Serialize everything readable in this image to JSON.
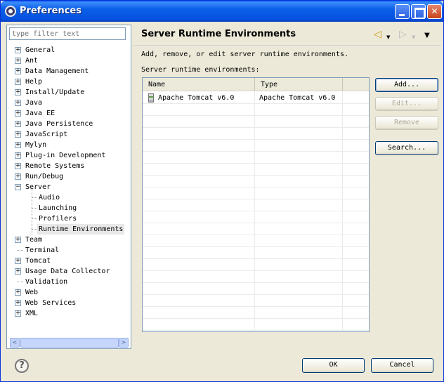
{
  "window": {
    "title": "Preferences"
  },
  "filter": {
    "placeholder": "type filter text"
  },
  "tree": [
    {
      "label": "General",
      "expander": "+"
    },
    {
      "label": "Ant",
      "expander": "+"
    },
    {
      "label": "Data Management",
      "expander": "+"
    },
    {
      "label": "Help",
      "expander": "+"
    },
    {
      "label": "Install/Update",
      "expander": "+"
    },
    {
      "label": "Java",
      "expander": "+"
    },
    {
      "label": "Java EE",
      "expander": "+"
    },
    {
      "label": "Java Persistence",
      "expander": "+"
    },
    {
      "label": "JavaScript",
      "expander": "+"
    },
    {
      "label": "Mylyn",
      "expander": "+"
    },
    {
      "label": "Plug-in Development",
      "expander": "+"
    },
    {
      "label": "Remote Systems",
      "expander": "+"
    },
    {
      "label": "Run/Debug",
      "expander": "+"
    },
    {
      "label": "Server",
      "expander": "−"
    },
    {
      "label": "Audio"
    },
    {
      "label": "Launching"
    },
    {
      "label": "Profilers"
    },
    {
      "label": "Runtime Environments"
    },
    {
      "label": "Team",
      "expander": "+"
    },
    {
      "label": "Terminal"
    },
    {
      "label": "Tomcat",
      "expander": "+"
    },
    {
      "label": "Usage Data Collector",
      "expander": "+"
    },
    {
      "label": "Validation"
    },
    {
      "label": "Web",
      "expander": "+"
    },
    {
      "label": "Web Services",
      "expander": "+"
    },
    {
      "label": "XML",
      "expander": "+"
    }
  ],
  "page": {
    "title": "Server Runtime Environments",
    "description": "Add, remove, or edit server runtime environments.",
    "list_label": "Server runtime environments:"
  },
  "table": {
    "columns": [
      "Name",
      "Type"
    ],
    "rows": [
      {
        "name": "Apache Tomcat v6.0",
        "type": "Apache Tomcat v6.0"
      }
    ]
  },
  "buttons": {
    "add": "Add...",
    "edit": "Edit...",
    "remove": "Remove",
    "search": "Search...",
    "ok": "OK",
    "cancel": "Cancel"
  },
  "icons": {
    "back": "◁",
    "forward": "▷",
    "menu": "▼"
  }
}
